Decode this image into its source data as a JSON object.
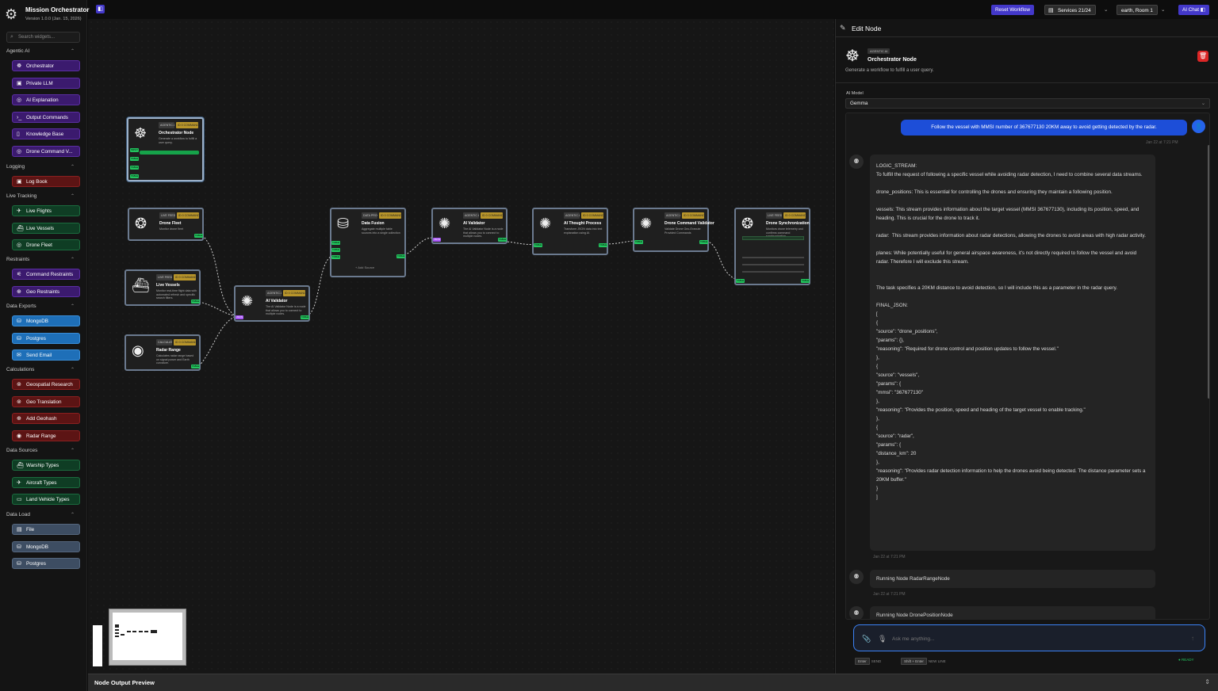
{
  "app": {
    "title": "Mission Orchestrator",
    "version": "Version 1.0.0 (Jan. 15, 2026)"
  },
  "search": {
    "placeholder": "Search widgets..."
  },
  "sidebar": {
    "groups": [
      {
        "label": "Agentic AI",
        "items": [
          "Orchestrator",
          "Private LLM",
          "AI Explanation",
          "Output Commands",
          "Knowledge Base",
          "Drone Command V..."
        ]
      },
      {
        "label": "Logging",
        "items": [
          "Log Book"
        ]
      },
      {
        "label": "Live Tracking",
        "items": [
          "Live Flights",
          "Live Vessels",
          "Drone Fleet"
        ]
      },
      {
        "label": "Restraints",
        "items": [
          "Command Restraints",
          "Geo Restraints"
        ]
      },
      {
        "label": "Data Exports",
        "items": [
          "MongoDB",
          "Postgres",
          "Send Email"
        ]
      },
      {
        "label": "Calculations",
        "items": [
          "Geospatial Research",
          "Geo Translation",
          "Add Geohash",
          "Radar Range"
        ]
      },
      {
        "label": "Data Sources",
        "items": [
          "Warship Types",
          "Aircraft Types",
          "Land Vehicle Types"
        ]
      },
      {
        "label": "Data Load",
        "items": [
          "File",
          "MongoDB",
          "Postgres"
        ]
      }
    ]
  },
  "topbar": {
    "reset": "Reset Workflow",
    "services": "Services 21/24",
    "room": "earth, Room 1",
    "chat": "AI Chat"
  },
  "nodes": {
    "orchestrator": {
      "title": "Orchestrator Node",
      "tag1": "AGENTIC AI",
      "tag2": "ID 0 COMMAND",
      "desc": "Generate a workflow to fulfill a user query."
    },
    "drone_fleet": {
      "title": "Drone Fleet",
      "tag1": "LIVE FEED",
      "tag2": "ID 0 COMMAND",
      "desc": "Monitor drone fleet"
    },
    "live_vessels": {
      "title": "Live Vessels",
      "tag1": "LIVE FEED",
      "tag2": "ID 0 COMMAND",
      "desc": "Monitor real-time flight data with automated refresh and specific search filters."
    },
    "radar_range": {
      "title": "Radar Range",
      "tag1": "CALCULATIONS",
      "tag2": "ID 0 COMMAND",
      "desc": "Calculates radar range based on signal power and Earth curvature."
    },
    "ai_validator_1": {
      "title": "AI Validator",
      "tag1": "AGENTIC AI",
      "tag2": "ID 0 COMMAND",
      "desc": "The AI Validator Node is a node that allows you to connect to multiple nodes."
    },
    "data_fusion": {
      "title": "Data Fusion",
      "tag1": "DATA PROCESSING",
      "tag2": "ID 0 COMMAND",
      "desc": "Aggregate multiple table sources into a single collection",
      "add": "+ Add Source"
    },
    "ai_validator_2": {
      "title": "AI Validator",
      "tag1": "AGENTIC AI",
      "tag2": "ID 0 COMMAND",
      "desc": "The AI Validator Node is a node that allows you to connect to multiple nodes."
    },
    "ai_thought": {
      "title": "AI Thought Process",
      "tag1": "AGENTIC AI",
      "tag2": "ID 0 COMMAND",
      "desc": "Transform JSON data into text explanation using AI."
    },
    "drone_cmd": {
      "title": "Drone Command Validator",
      "tag1": "AGENTIC AI",
      "tag2": "ID 0 COMMAND",
      "desc": "Validate Drone Geo-Execute Provided Commands"
    },
    "drone_sync": {
      "title": "Drone Synchronization",
      "tag1": "LIVE FEED",
      "tag2": "ID 0 COMMAND",
      "desc": "Monitors drone telemetry and confirms command synchronization."
    }
  },
  "ports": {
    "input": "INPUT",
    "table": "TABLE",
    "json": "JSON"
  },
  "bottom": {
    "title": "Node Output Preview"
  },
  "panel": {
    "header": "Edit Node",
    "node_tag": "AGENTIC AI",
    "node_title": "Orchestrator Node",
    "node_desc": "Generate a workflow to fulfill a user query.",
    "model_label": "AI Model",
    "model_value": "Gemma",
    "chat": {
      "user_msg": "Follow the vessel with MMSI number of 367677130 20KM away to avoid getting detected by the radar.",
      "user_time": "Jan 22 at 7:21 PM",
      "bot_time": "Jan 22 at 7:21 PM",
      "lines": [
        "LOGIC_STREAM:",
        "To fulfill the request of following a specific vessel while avoiding radar detection, I need to combine several data streams.",
        "",
        "drone_positions: This is essential for controlling the drones and ensuring they maintain a following position.",
        "",
        "vessels: This stream provides information about the target vessel (MMSI 367677130), including its position, speed, and heading. This is crucial for the drone to track it.",
        "",
        "radar:  This stream provides information about radar detections, allowing the drones to avoid areas with high radar activity.",
        "",
        "planes: While potentially useful for general airspace awareness, it's not directly required to follow the vessel and avoid radar. Therefore I will exclude this stream.",
        "",
        "",
        "The task specifies a 20KM distance to avoid detection, so I will include this as a parameter in the radar query.",
        "",
        "FINAL_JSON:",
        "[",
        "{",
        "\"source\": \"drone_positions\",",
        "\"params\": {},",
        "\"reasoning\": \"Required for drone control and position updates to follow the vessel.\"",
        "},",
        "{",
        "\"source\": \"vessels\",",
        "\"params\": {",
        "\"mmsi\": \"367677130\"",
        "},",
        "\"reasoning\": \"Provides the position, speed and heading of the target vessel to enable tracking.\"",
        "},",
        "{",
        "\"source\": \"radar\",",
        "\"params\": {",
        "\"distance_km\": 20",
        "},",
        "\"reasoning\": \"Provides radar detection information to help the drones avoid being detected. The distance parameter sets a 20KM buffer.\"",
        "}",
        "]"
      ],
      "run1": "Running Node RadarRangeNode",
      "run1_time": "Jan 22 at 7:21 PM",
      "run2": "Running Node DronePositionNode"
    },
    "input_placeholder": "Ask me anything...",
    "hint_enter": "Enter",
    "hint_send": "SEND",
    "hint_shift": "Shift + Enter",
    "hint_newline": "NEW LINE",
    "ready": "● READY"
  }
}
